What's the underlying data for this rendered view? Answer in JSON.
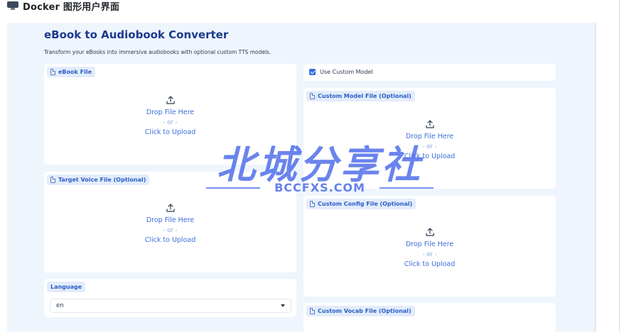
{
  "page_header": {
    "title": "Docker 图形用户界面"
  },
  "app": {
    "title": "eBook to Audiobook Converter",
    "description": "Transform your eBooks into immersive audiobooks with optional custom TTS models."
  },
  "uploaders": {
    "ebook": {
      "label": "eBook File",
      "drop": "Drop File Here",
      "or": "- or -",
      "click": "Click to Upload"
    },
    "voice": {
      "label": "Target Voice File (Optional)",
      "drop": "Drop File Here",
      "or": "- or -",
      "click": "Click to Upload"
    },
    "model": {
      "label": "Custom Model File (Optional)",
      "drop": "Drop File Here",
      "or": "- or -",
      "click": "Click to Upload"
    },
    "config": {
      "label": "Custom Config File (Optional)",
      "drop": "Drop File Here",
      "or": "- or -",
      "click": "Click to Upload"
    },
    "vocab": {
      "label": "Custom Vocab File (Optional)"
    }
  },
  "custom_model": {
    "label": "Use Custom Model",
    "checked": true
  },
  "language": {
    "label": "Language",
    "value": "en"
  },
  "watermark": {
    "cn": "北城分享社",
    "en": "BCCFXS.COM"
  },
  "colors": {
    "accent": "#2f6fe0",
    "title": "#1a3a8f",
    "panel_bg": "#eff5fd"
  }
}
